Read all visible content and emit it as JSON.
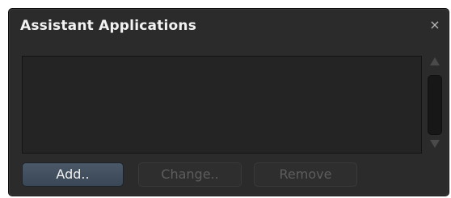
{
  "dialog": {
    "title": "Assistant Applications",
    "close_glyph": "×",
    "close_icon": "close-icon"
  },
  "list": {
    "items": []
  },
  "buttons": {
    "add": {
      "label": "Add..",
      "enabled": true
    },
    "change": {
      "label": "Change..",
      "enabled": false
    },
    "remove": {
      "label": "Remove",
      "enabled": false
    }
  },
  "colors": {
    "background": "#2b2b2b",
    "accent_button": "#425061",
    "text": "#f2f2f2",
    "disabled_text": "#5d5d5d"
  }
}
